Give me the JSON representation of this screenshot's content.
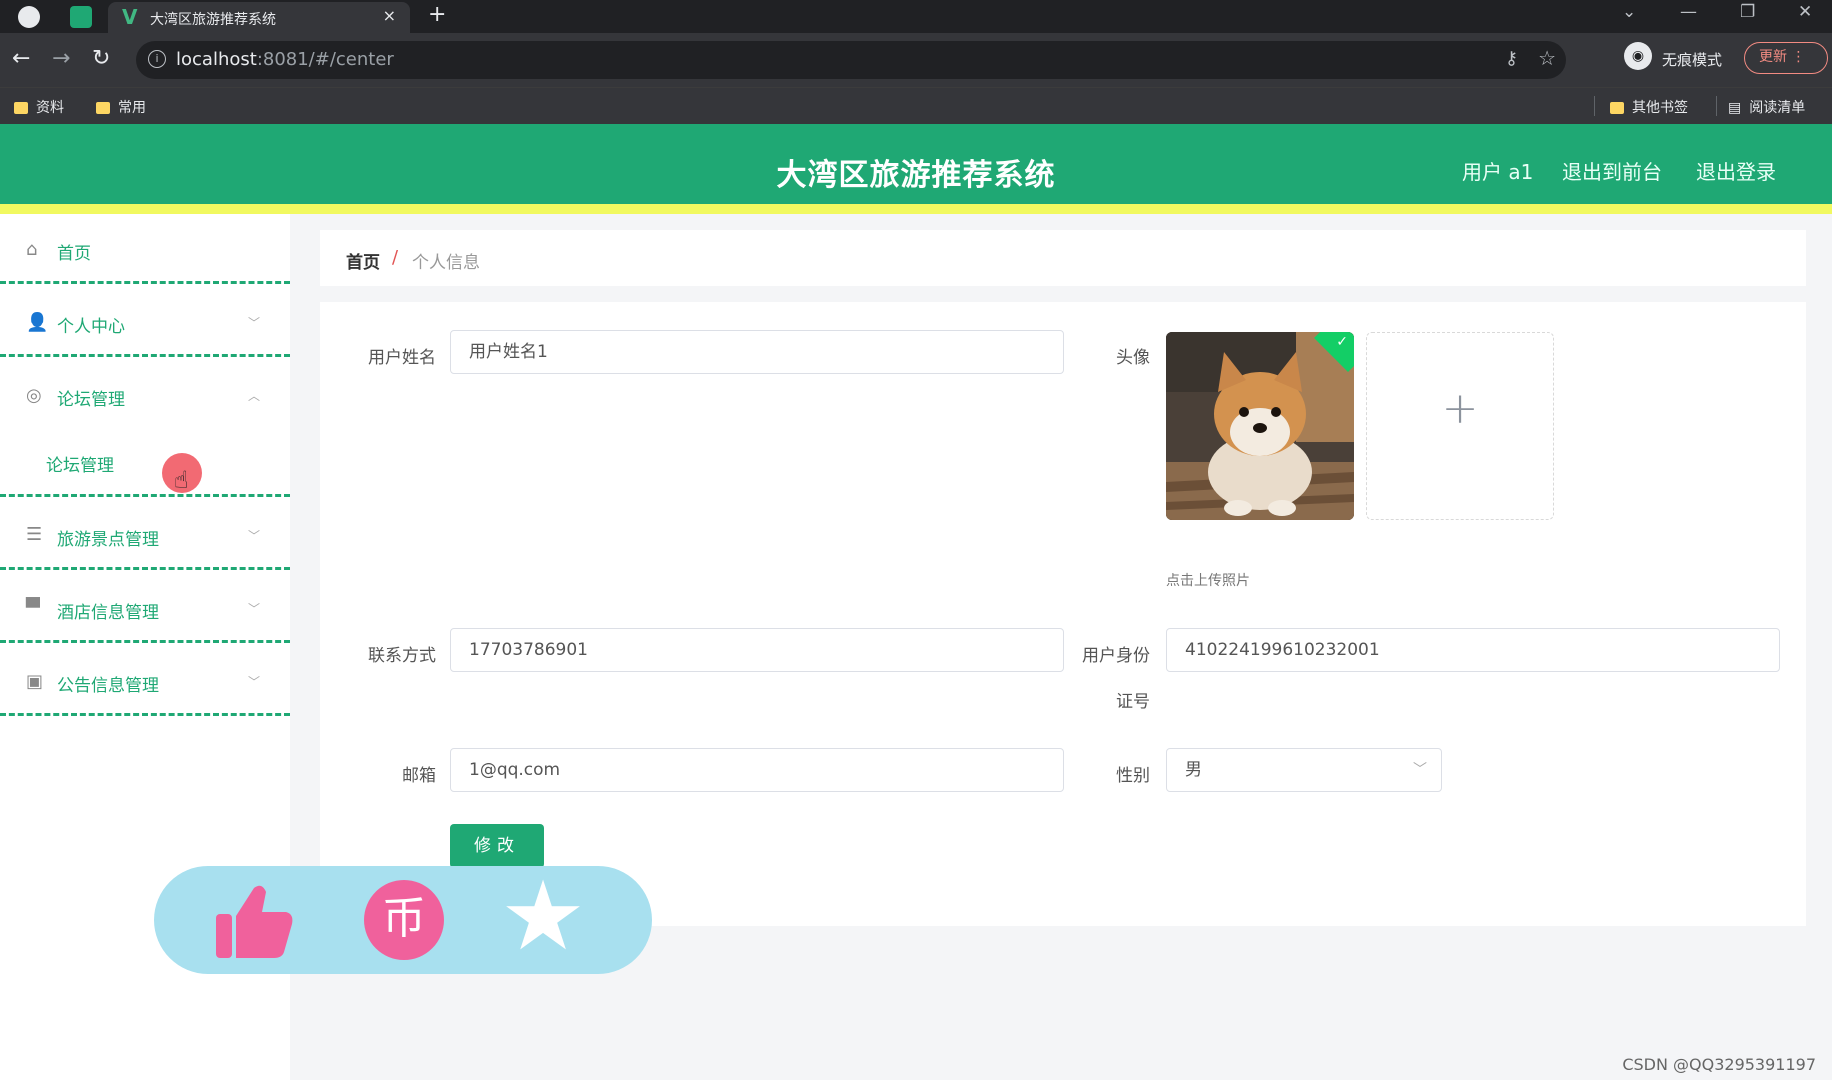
{
  "browser": {
    "tab_title": "大湾区旅游推荐系统",
    "tab_close": "×",
    "new_tab": "+",
    "url_host": "localhost",
    "url_rest": ":8081/#/center",
    "incognito_label": "无痕模式",
    "update_label": "更新",
    "bookmarks": [
      "资料",
      "常用"
    ],
    "bookmarks_right": [
      "其他书签",
      "阅读清单"
    ]
  },
  "header": {
    "title": "大湾区旅游推荐系统",
    "user": "用户 a1",
    "exit_front": "退出到前台",
    "logout": "退出登录"
  },
  "sidebar": {
    "items": [
      {
        "label": "首页",
        "icon": "home-icon"
      },
      {
        "label": "个人中心",
        "icon": "user-icon"
      },
      {
        "label": "论坛管理",
        "icon": "forum-icon"
      },
      {
        "label": "旅游景点管理",
        "icon": "list-icon"
      },
      {
        "label": "酒店信息管理",
        "icon": "hotel-icon"
      },
      {
        "label": "公告信息管理",
        "icon": "notice-icon"
      }
    ],
    "sub_item": "论坛管理"
  },
  "breadcrumb": {
    "home": "首页",
    "sep": "/",
    "current": "个人信息"
  },
  "form": {
    "username_label": "用户姓名",
    "username_value": "用户姓名1",
    "avatar_label": "头像",
    "upload_hint": "点击上传照片",
    "phone_label": "联系方式",
    "phone_value": "17703786901",
    "idcard_label_1": "用户身份",
    "idcard_label_2": "证号",
    "idcard_value": "410224199610232001",
    "email_label": "邮箱",
    "email_value": "1@qq.com",
    "gender_label": "性别",
    "gender_value": "男",
    "submit_label": "修改"
  },
  "overlay": {
    "coin_glyph": "币"
  },
  "watermark": "CSDN @QQ3295391197"
}
